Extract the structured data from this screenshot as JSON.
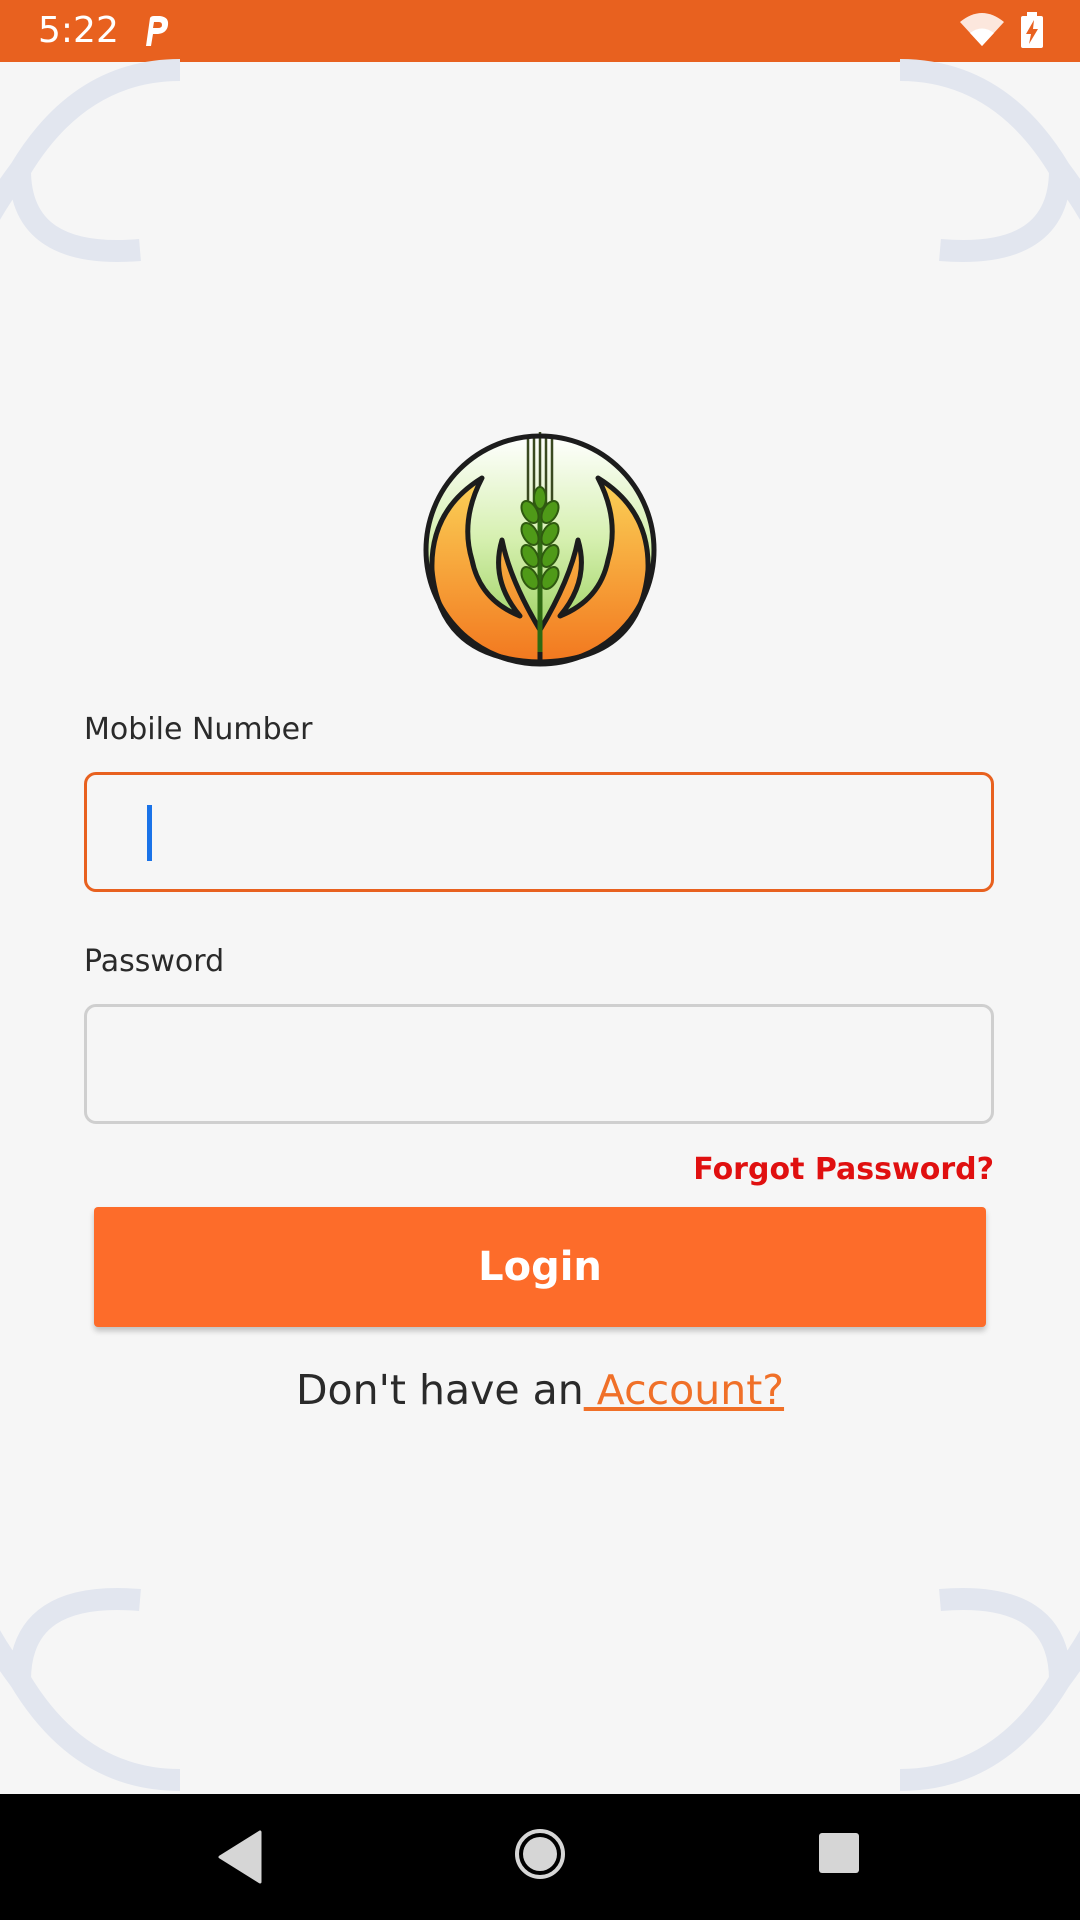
{
  "status_bar": {
    "time": "5:22",
    "notification_icon": "p-app-icon",
    "wifi_icon": "wifi-icon",
    "battery_icon": "battery-charging-icon",
    "background_color": "#e8611f"
  },
  "logo": {
    "icon": "wheat-hands-logo"
  },
  "form": {
    "mobile_label": "Mobile Number",
    "mobile_value": "",
    "password_label": "Password",
    "password_value": "",
    "forgot_password": "Forgot Password?",
    "login_button": "Login",
    "signup_prefix": "Don't have an",
    "signup_link": " Account?"
  },
  "colors": {
    "accent": "#fd6c2a",
    "focus_border": "#e8611f",
    "forgot_link": "#e01010",
    "caret": "#1a73e8"
  },
  "nav_bar": {
    "back_icon": "back-triangle-icon",
    "home_icon": "home-circle-icon",
    "recents_icon": "recents-square-icon"
  }
}
